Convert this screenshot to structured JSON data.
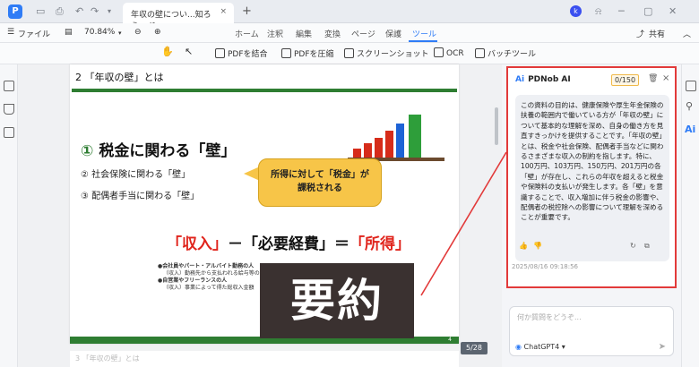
{
  "titlebar": {
    "tab_title": "年収の壁につい...知ろう.pdf",
    "tab_close": "×",
    "new_tab": "+",
    "user_initial": "k"
  },
  "toolbar": {
    "file_label": "ファイル",
    "zoom": "70.84%",
    "menus": [
      "ホーム",
      "注釈",
      "編集",
      "変換",
      "ページ",
      "保護",
      "ツール"
    ],
    "active_menu": "ツール",
    "share_label": "共有"
  },
  "tools": {
    "merge": "PDFを結合",
    "compress": "PDFを圧縮",
    "screenshot": "スクリーンショット",
    "ocr": "OCR",
    "batch": "バッチツール"
  },
  "document": {
    "page_title": "2 「年収の壁」とは",
    "heading_num": "①",
    "heading_text": "税金に関わる「壁」",
    "item2": "② 社会保険に関わる「壁」",
    "item3": "③ 配偶者手当に関わる「壁」",
    "callout": [
      "所得に対して「税金」が",
      "課税される"
    ],
    "formula_1": "「収入」",
    "formula_2": "－「必要経費」＝",
    "formula_3": "「所得」",
    "note1": "●会社員やパート・アルバイト勤務の人",
    "note2": "（収入）勤務先から支払われる給与等の",
    "note3": "●自営業やフリーランスの人",
    "note4": "（収入）事業によって得た総収入金額",
    "overlay": "要約",
    "page_foot": "4",
    "next_page_title": "3 「年収の壁」とは",
    "page_indicator": "5/28"
  },
  "ai_panel": {
    "title": "PDNob AI",
    "counter": "0/150",
    "message": "この資料の目的は、健康保険や厚生年金保険の扶養の範囲内で働いている方が「年収の壁」について基本的な理解を深め、自身の働き方を見直すきっかけを提供することです。「年収の壁」とは、税金や社会保険、配偶者手当などに関わるさまざまな収入の制約を指します。特に、100万円、103万円、150万円、201万円の各「壁」が存在し、これらの年収を超えると税金や保険料の支払いが発生します。各「壁」を意識することで、収入増加に伴う税金の影響や、配偶者の税控除への影響について理解を深めることが重要です。",
    "timestamp": "2025/08/16 09:18:56",
    "input_placeholder": "何か質問をどうぞ...",
    "model": "ChatGPT4"
  },
  "colors": {
    "accent": "#2f7cf6",
    "highlight_border": "#e23a3a",
    "slide_green": "#2e7d32",
    "callout_yellow": "#f7c548"
  }
}
